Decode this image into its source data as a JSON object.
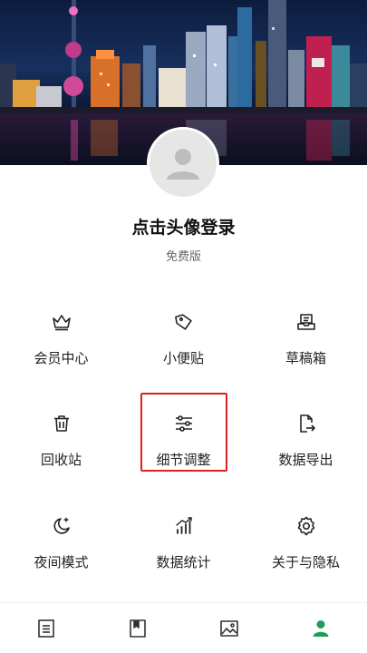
{
  "profile": {
    "login_prompt": "点击头像登录",
    "plan": "免费版"
  },
  "menu": {
    "items": [
      {
        "label": "会员中心",
        "icon": "crown-icon"
      },
      {
        "label": "小便贴",
        "icon": "tag-icon"
      },
      {
        "label": "草稿箱",
        "icon": "draft-icon"
      },
      {
        "label": "回收站",
        "icon": "trash-icon"
      },
      {
        "label": "细节调整",
        "icon": "sliders-icon"
      },
      {
        "label": "数据导出",
        "icon": "export-icon"
      },
      {
        "label": "夜间模式",
        "icon": "moon-icon"
      },
      {
        "label": "数据统计",
        "icon": "stats-icon"
      },
      {
        "label": "关于与隐私",
        "icon": "gear-icon"
      }
    ],
    "highlighted": "细节调整"
  },
  "bottom_nav": {
    "items": [
      {
        "icon": "notes-icon",
        "active": false
      },
      {
        "icon": "bookmark-icon",
        "active": false
      },
      {
        "icon": "image-icon",
        "active": false
      },
      {
        "icon": "profile-icon",
        "active": true
      }
    ]
  },
  "colors": {
    "accent": "#1f9d57",
    "highlight_border": "#e02020",
    "icon": "#222222"
  }
}
